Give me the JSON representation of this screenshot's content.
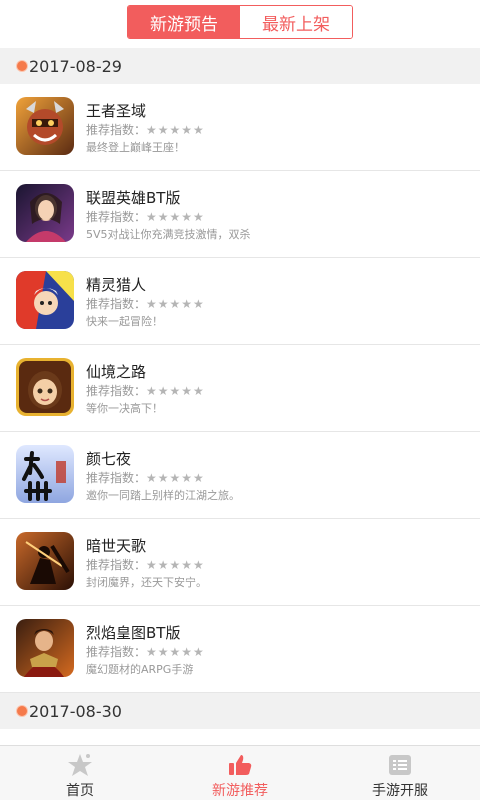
{
  "tabs": [
    {
      "label": "新游预告",
      "active": true
    },
    {
      "label": "最新上架",
      "active": false
    }
  ],
  "groups": [
    {
      "date": "2017-08-29",
      "games": [
        {
          "title": "王者圣域",
          "rating_label": "推荐指数：",
          "stars": "★★★★★",
          "desc": "最终登上巅峰王座！"
        },
        {
          "title": "联盟英雄BT版",
          "rating_label": "推荐指数：",
          "stars": "★★★★★",
          "desc": "5V5对战让你充满竞技激情，双杀"
        },
        {
          "title": "精灵猎人",
          "rating_label": "推荐指数：",
          "stars": "★★★★★",
          "desc": "快来一起冒险！"
        },
        {
          "title": "仙境之路",
          "rating_label": "推荐指数：",
          "stars": "★★★★★",
          "desc": "等你一决高下！"
        },
        {
          "title": "颜七夜",
          "rating_label": "推荐指数：",
          "stars": "★★★★★",
          "desc": "邀你一同踏上别样的江湖之旅。"
        },
        {
          "title": "暗世天歌",
          "rating_label": "推荐指数：",
          "stars": "★★★★★",
          "desc": "封闭魔界，还天下安宁。"
        },
        {
          "title": "烈焰皇图BT版",
          "rating_label": "推荐指数：",
          "stars": "★★★★★",
          "desc": "魔幻题材的ARPG手游"
        }
      ]
    },
    {
      "date": "2017-08-30",
      "games": []
    }
  ],
  "bottom_nav": [
    {
      "label": "首页",
      "icon": "star-icon",
      "active": false
    },
    {
      "label": "新游推荐",
      "icon": "thumbs-up-icon",
      "active": true
    },
    {
      "label": "手游开服",
      "icon": "list-icon",
      "active": false
    }
  ],
  "colors": {
    "accent": "#f25d5d",
    "date_dot": "#f57a4b"
  }
}
